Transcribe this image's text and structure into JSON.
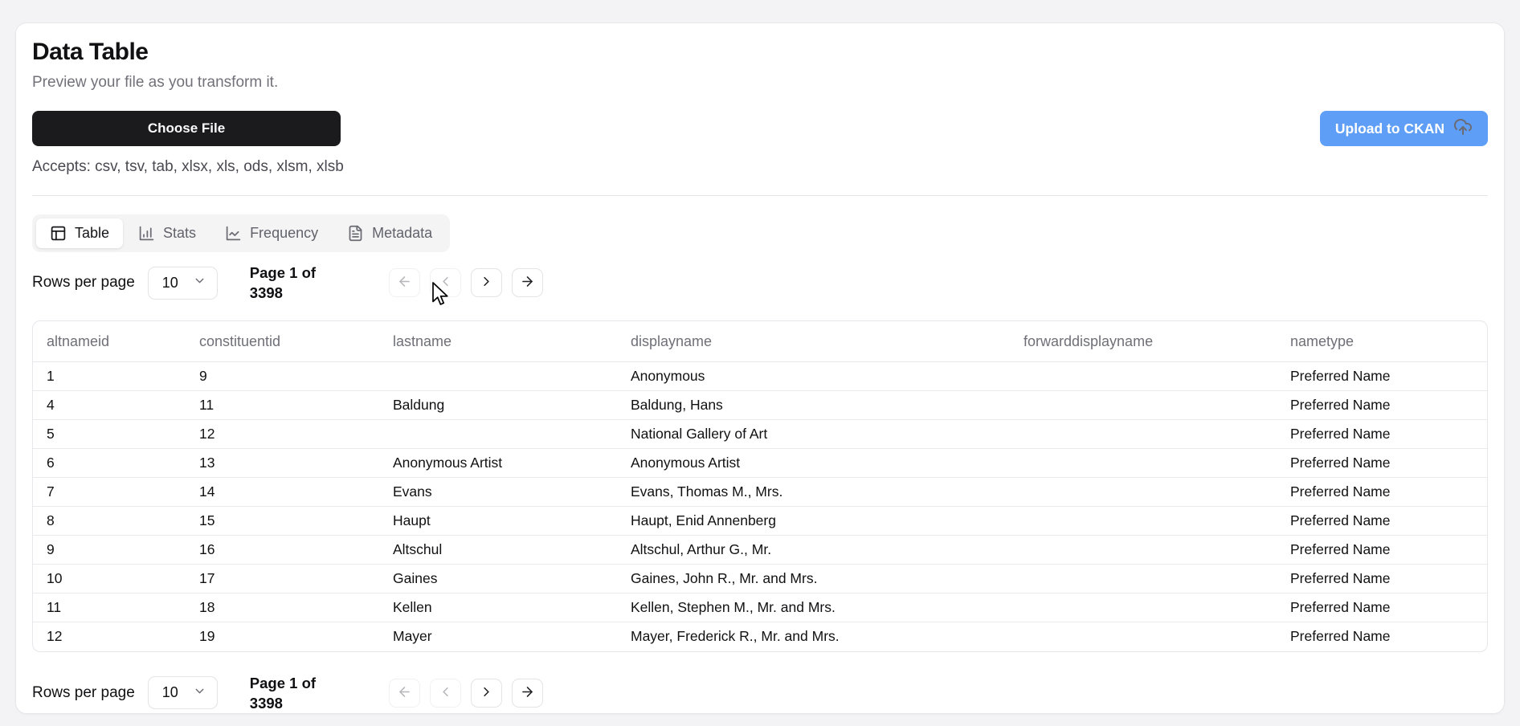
{
  "header": {
    "title": "Data Table",
    "subtitle": "Preview your file as you transform it."
  },
  "upload": {
    "choose_file_label": "Choose File",
    "accepts_note": "Accepts: csv, tsv, tab, xlsx, xls, ods, xlsm, xlsb",
    "ckan_label": "Upload to CKAN",
    "ckan_icon": "cloud-upload-icon"
  },
  "tabs": [
    {
      "label": "Table",
      "icon": "table-icon",
      "active": true
    },
    {
      "label": "Stats",
      "icon": "bar-chart-icon",
      "active": false
    },
    {
      "label": "Frequency",
      "icon": "line-chart-icon",
      "active": false
    },
    {
      "label": "Metadata",
      "icon": "file-text-icon",
      "active": false
    }
  ],
  "pagination": {
    "rows_per_page_label": "Rows per page",
    "rows_per_page_value": "10",
    "page_info_line1": "Page 1 of",
    "page_info_line2": "3398",
    "buttons": [
      {
        "name": "first-page",
        "icon": "arrow-left-icon",
        "enabled": false
      },
      {
        "name": "previous-page",
        "icon": "chevron-left-icon",
        "enabled": false
      },
      {
        "name": "next-page",
        "icon": "chevron-right-icon",
        "enabled": true
      },
      {
        "name": "last-page",
        "icon": "arrow-right-icon",
        "enabled": true
      }
    ]
  },
  "table": {
    "columns": [
      "altnameid",
      "constituentid",
      "lastname",
      "displayname",
      "forwarddisplayname",
      "nametype"
    ],
    "rows": [
      [
        "1",
        "9",
        "",
        "Anonymous",
        "",
        "Preferred Name"
      ],
      [
        "4",
        "11",
        "Baldung",
        "Baldung, Hans",
        "",
        "Preferred Name"
      ],
      [
        "5",
        "12",
        "",
        "National Gallery of Art",
        "",
        "Preferred Name"
      ],
      [
        "6",
        "13",
        "Anonymous Artist",
        "Anonymous Artist",
        "",
        "Preferred Name"
      ],
      [
        "7",
        "14",
        "Evans",
        "Evans, Thomas M., Mrs.",
        "",
        "Preferred Name"
      ],
      [
        "8",
        "15",
        "Haupt",
        "Haupt, Enid Annenberg",
        "",
        "Preferred Name"
      ],
      [
        "9",
        "16",
        "Altschul",
        "Altschul, Arthur G., Mr.",
        "",
        "Preferred Name"
      ],
      [
        "10",
        "17",
        "Gaines",
        "Gaines, John R., Mr. and Mrs.",
        "",
        "Preferred Name"
      ],
      [
        "11",
        "18",
        "Kellen",
        "Kellen, Stephen M., Mr. and Mrs.",
        "",
        "Preferred Name"
      ],
      [
        "12",
        "19",
        "Mayer",
        "Mayer, Frederick R., Mr. and Mrs.",
        "",
        "Preferred Name"
      ]
    ]
  },
  "colors": {
    "accent_blue": "#5e9ef6",
    "primary_button_bg": "#1b1b1e",
    "muted_text": "#71717a",
    "border": "#e5e7eb",
    "page_background": "#f3f3f5",
    "tab_bar_background": "#f4f4f5"
  }
}
